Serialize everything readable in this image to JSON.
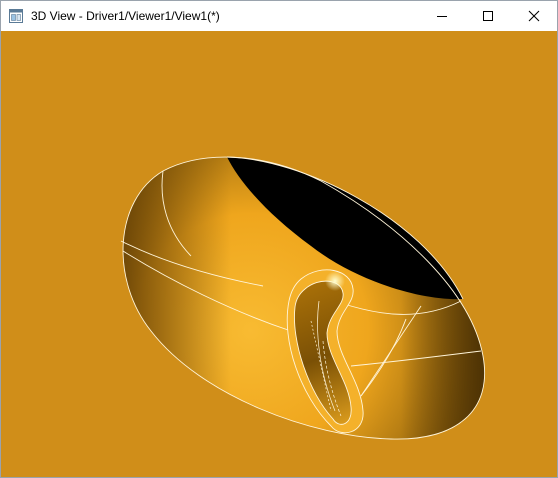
{
  "window": {
    "title": "3D View - Driver1/Viewer1/View1(*)",
    "controls": {
      "minimize": "minimize-icon",
      "maximize": "maximize-icon",
      "close": "close-icon"
    }
  },
  "viewport": {
    "background_color": "#D08E19",
    "shape_colors": {
      "highlight": "#F8BB32",
      "base": "#EFA61D",
      "shadow": "#6E4A06",
      "hole": "#000000",
      "edges": "#FFF4D8"
    }
  }
}
